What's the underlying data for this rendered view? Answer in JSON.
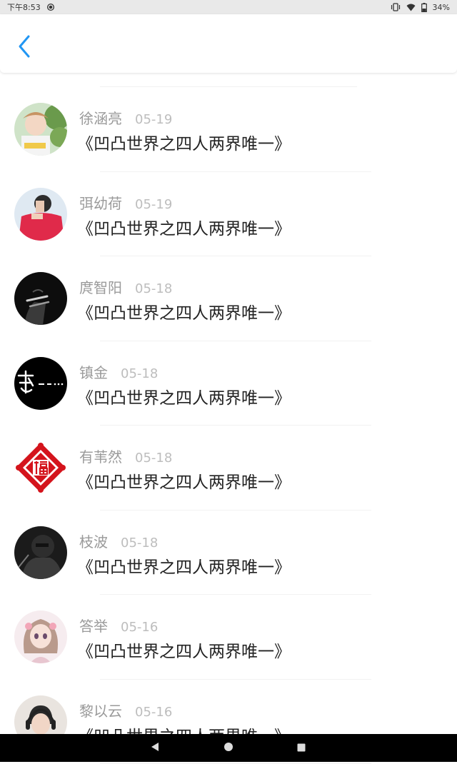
{
  "status_bar": {
    "time": "下午8:53",
    "battery": "34%"
  },
  "header": {
    "back_icon": "chevron-left-icon"
  },
  "list": [
    {
      "name": "徐涵亮",
      "date": "05-19",
      "title": "《凹凸世界之四人两界唯一》",
      "avatar": "girl-with-flowers-photo"
    },
    {
      "name": "弭幼荷",
      "date": "05-19",
      "title": "《凹凸世界之四人两界唯一》",
      "avatar": "person-red-shirt-photo"
    },
    {
      "name": "庹智阳",
      "date": "05-18",
      "title": "《凹凸世界之四人两界唯一》",
      "avatar": "dark-hand-cigarette-photo"
    },
    {
      "name": "镇金",
      "date": "05-18",
      "title": "《凹凸世界之四人两界唯一》",
      "avatar": "black-calligraphy-image"
    },
    {
      "name": "有苇然",
      "date": "05-18",
      "title": "《凹凸世界之四人两界唯一》",
      "avatar": "red-fu-papercut-image"
    },
    {
      "name": "枝波",
      "date": "05-18",
      "title": "《凹凸世界之四人两界唯一》",
      "avatar": "dark-person-photo"
    },
    {
      "name": "答举",
      "date": "05-16",
      "title": "《凹凸世界之四人两界唯一》",
      "avatar": "anime-girl-illustration"
    },
    {
      "name": "黎以云",
      "date": "05-16",
      "title": "《凹凸世界之四人两界唯一》",
      "avatar": "boy-headphones-photo"
    }
  ],
  "colors": {
    "accent": "#2196f3",
    "name_text": "#9a9a9a",
    "date_text": "#bdbdbd",
    "title_text": "#222222"
  }
}
